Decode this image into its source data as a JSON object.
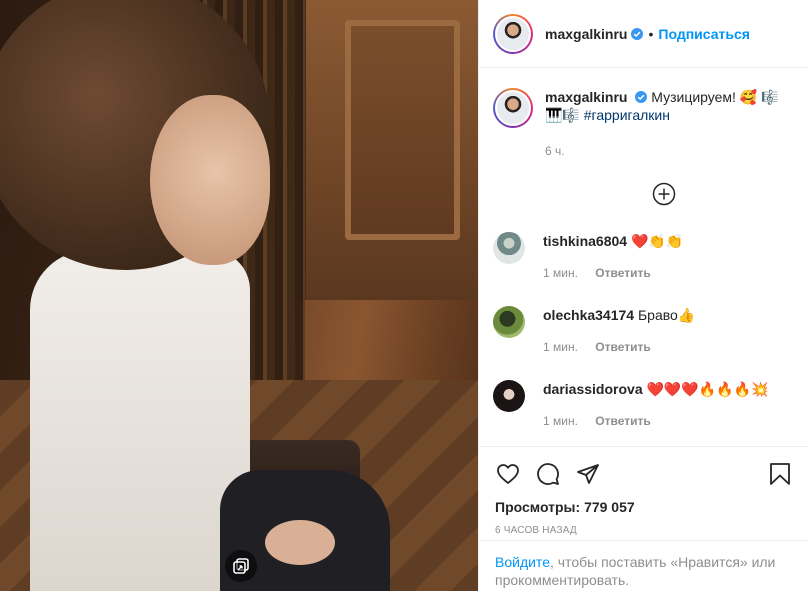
{
  "header": {
    "username": "maxgalkinru",
    "separator": "•",
    "follow_label": "Подписаться"
  },
  "caption": {
    "username": "maxgalkinru",
    "text": "Музицируем! 🥰 🎼🎹🎼 ",
    "hashtag": "#гарригалкин",
    "time": "6 ч."
  },
  "comments": [
    {
      "username": "tishkina6804",
      "text": "❤️👏👏",
      "time": "1 мин.",
      "reply": "Ответить"
    },
    {
      "username": "olechka34174",
      "text": "Браво👍",
      "time": "1 мин.",
      "reply": "Ответить"
    },
    {
      "username": "dariassidorova",
      "text": "❤️❤️❤️🔥🔥🔥💥",
      "time": "1 мин.",
      "reply": "Ответить"
    }
  ],
  "stats": {
    "views_label": "Просмотры:",
    "views_value": "779 057",
    "posted": "6 часов назад"
  },
  "login": {
    "link": "Войдите",
    "rest": ", чтобы поставить «Нравится» или прокомментировать."
  },
  "icons": {
    "verified": "verified-badge-icon",
    "like": "heart-icon",
    "comment": "comment-icon",
    "share": "share-icon",
    "save": "bookmark-icon",
    "more": "plus-circle-icon",
    "media": "video-indicator-icon"
  },
  "colors": {
    "accent": "#0095f6",
    "verified": "#3897f0",
    "muted": "#8e8e8e",
    "text": "#262626"
  }
}
